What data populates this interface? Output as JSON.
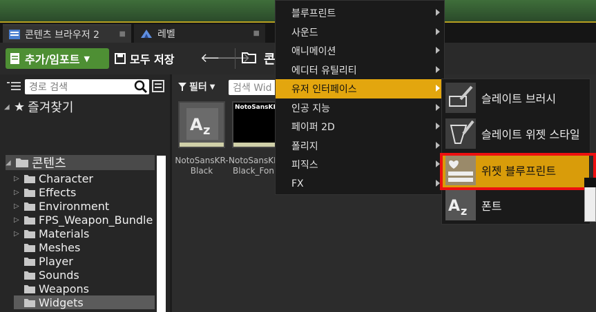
{
  "tabs": [
    {
      "label": "콘텐츠 브라우저 2",
      "icon": "content-browser-icon"
    },
    {
      "label": "레벨",
      "icon": "level-icon"
    }
  ],
  "toolbar": {
    "add_import_label": "추가/임포트",
    "save_all_label": "모두 저장",
    "path_text": "콘"
  },
  "left_panel": {
    "path_search_placeholder": "경로 검색",
    "favorites_label": "즐겨찾기",
    "content_root": "콘텐츠",
    "folders": [
      {
        "label": "Character",
        "expandable": true,
        "selected": false
      },
      {
        "label": "Effects",
        "expandable": true,
        "selected": false
      },
      {
        "label": "Environment",
        "expandable": true,
        "selected": false
      },
      {
        "label": "FPS_Weapon_Bundle",
        "expandable": true,
        "selected": false
      },
      {
        "label": "Materials",
        "expandable": true,
        "selected": false
      },
      {
        "label": "Meshes",
        "expandable": false,
        "selected": false
      },
      {
        "label": "Player",
        "expandable": false,
        "selected": false
      },
      {
        "label": "Sounds",
        "expandable": false,
        "selected": false
      },
      {
        "label": "Weapons",
        "expandable": false,
        "selected": false
      },
      {
        "label": "Widgets",
        "expandable": false,
        "selected": true
      }
    ]
  },
  "right_panel": {
    "filter_label": "필터",
    "search_placeholder": "검색 Wid",
    "assets": [
      {
        "label": "NotoSansKR-Black",
        "icon": "font-asset-icon"
      },
      {
        "label": "NotoSansKR-Black_Fon",
        "thumb_text": "NotoSansKR",
        "icon": "font-face-asset"
      }
    ]
  },
  "context_menu": {
    "items": [
      {
        "label": "블루프린트",
        "highlighted": false
      },
      {
        "label": "사운드",
        "highlighted": false
      },
      {
        "label": "애니메이션",
        "highlighted": false
      },
      {
        "label": "에디터 유틸리티",
        "highlighted": false
      },
      {
        "label": "유저 인터페이스",
        "highlighted": true
      },
      {
        "label": "인공 지능",
        "highlighted": false
      },
      {
        "label": "페이퍼 2D",
        "highlighted": false
      },
      {
        "label": "폴리지",
        "highlighted": false
      },
      {
        "label": "피직스",
        "highlighted": false
      },
      {
        "label": "FX",
        "highlighted": false
      }
    ]
  },
  "submenu": {
    "items": [
      {
        "label": "슬레이트 브러시",
        "icon": "slate-brush-icon",
        "highlighted": false
      },
      {
        "label": "슬레이트 위젯 스타일",
        "icon": "slate-widget-style-icon",
        "highlighted": false
      },
      {
        "label": "위젯 블루프린트",
        "icon": "widget-blueprint-icon",
        "highlighted": true
      },
      {
        "label": "폰트",
        "icon": "font-icon",
        "highlighted": false
      }
    ]
  },
  "colors": {
    "add_button": "#4e8f34",
    "menu_highlight": "#e3a60e",
    "red_annotation": "#ee1010"
  }
}
